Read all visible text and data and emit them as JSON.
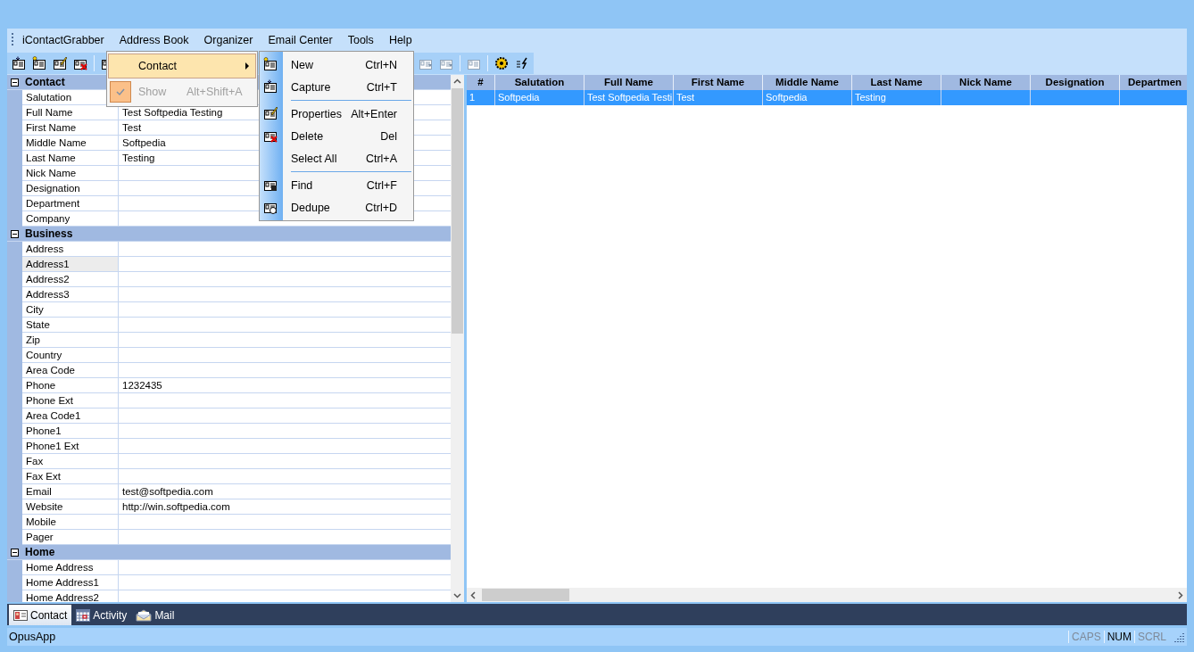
{
  "menu_bar": {
    "items": [
      {
        "label": "iContactGrabber"
      },
      {
        "label": "Address Book"
      },
      {
        "label": "Organizer"
      },
      {
        "label": "Email Center"
      },
      {
        "label": "Tools"
      },
      {
        "label": "Help"
      }
    ]
  },
  "toolbar": {
    "left_groups": [
      {
        "buttons": [
          {
            "kind": "capture"
          },
          {
            "kind": "new"
          },
          {
            "kind": "properties"
          },
          {
            "kind": "delete"
          }
        ]
      },
      {
        "buttons": [
          {
            "kind": "find"
          }
        ]
      }
    ],
    "right_groups": [
      {
        "buttons": [
          {
            "kind": "forward"
          },
          {
            "kind": "forward"
          }
        ]
      },
      {
        "buttons": [
          {
            "kind": "grid"
          }
        ]
      },
      {
        "buttons": [
          {
            "kind": "gear"
          },
          {
            "kind": "tools"
          }
        ]
      }
    ]
  },
  "property_grid": {
    "groups": [
      {
        "label": "Contact",
        "expanded": true,
        "rows": [
          {
            "name": "Salutation",
            "selected": false
          },
          {
            "name": "Full Name",
            "value": "Test Softpedia Testing",
            "selected": false
          },
          {
            "name": "First Name",
            "value": "Test",
            "selected": false
          },
          {
            "name": "Middle Name",
            "value": "Softpedia",
            "selected": false
          },
          {
            "name": "Last Name",
            "value": "Testing",
            "selected": false
          },
          {
            "name": "Nick Name",
            "selected": false
          },
          {
            "name": "Designation",
            "selected": false
          },
          {
            "name": "Department",
            "selected": false
          },
          {
            "name": "Company",
            "selected": false
          }
        ]
      },
      {
        "label": "Business",
        "expanded": true,
        "rows": [
          {
            "name": "Address",
            "selected": false
          },
          {
            "name": "Address1",
            "selected": true
          },
          {
            "name": "Address2",
            "selected": false
          },
          {
            "name": "Address3",
            "selected": false
          },
          {
            "name": "City",
            "selected": false
          },
          {
            "name": "State",
            "selected": false
          },
          {
            "name": "Zip",
            "selected": false
          },
          {
            "name": "Country",
            "selected": false
          },
          {
            "name": "Area Code",
            "selected": false
          },
          {
            "name": "Phone",
            "value": "1232435",
            "selected": false
          },
          {
            "name": "Phone Ext",
            "selected": false
          },
          {
            "name": "Area Code1",
            "selected": false
          },
          {
            "name": "Phone1",
            "selected": false
          },
          {
            "name": "Phone1 Ext",
            "selected": false
          },
          {
            "name": "Fax",
            "selected": false
          },
          {
            "name": "Fax Ext",
            "selected": false
          },
          {
            "name": "Email",
            "value": "test@softpedia.com",
            "selected": false
          },
          {
            "name": "Website",
            "value": "http://win.softpedia.com",
            "selected": false
          },
          {
            "name": "Mobile",
            "selected": false
          },
          {
            "name": "Pager",
            "selected": false
          }
        ]
      },
      {
        "label": "Home",
        "expanded": true,
        "rows": [
          {
            "name": "Home Address",
            "selected": false
          },
          {
            "name": "Home Address1",
            "selected": false
          },
          {
            "name": "Home Address2",
            "selected": false
          }
        ]
      }
    ]
  },
  "table": {
    "columns": [
      "#",
      "Salutation",
      "Full Name",
      "First Name",
      "Middle Name",
      "Last Name",
      "Nick Name",
      "Designation",
      "Departmen"
    ],
    "rows": [
      {
        "cells": [
          "1",
          "Softpedia",
          "Test Softpedia Testi",
          "Test",
          "Softpedia",
          "Testing",
          null,
          null,
          null
        ],
        "selected": true
      }
    ]
  },
  "bottom_tabs": [
    {
      "kind": "card",
      "label": "Contact",
      "selected": true
    },
    {
      "kind": "calendar",
      "label": "Activity",
      "selected": false
    },
    {
      "kind": "mail",
      "label": "Mail",
      "selected": false
    }
  ],
  "status_bar": {
    "text": "OpusApp",
    "indicators": [
      {
        "label": "CAPS",
        "on": false
      },
      {
        "label": "NUM",
        "on": true
      },
      {
        "label": "SCRL",
        "on": false
      }
    ]
  },
  "address_book_menu": {
    "items": [
      {
        "label": "Contact",
        "submenu": true,
        "selected": true,
        "checked": false,
        "disabled": false
      },
      {
        "label": "Show",
        "shortcut": "Alt+Shift+A",
        "submenu": false,
        "selected": false,
        "checked": true,
        "disabled": true
      }
    ]
  },
  "contact_submenu": {
    "items": [
      {
        "kind": "new",
        "label": "New",
        "shortcut": "Ctrl+N"
      },
      {
        "kind": "capture",
        "label": "Capture",
        "shortcut": "Ctrl+T"
      },
      {
        "kind": "separator"
      },
      {
        "kind": "properties",
        "label": "Properties",
        "shortcut": "Alt+Enter"
      },
      {
        "kind": "delete",
        "label": "Delete",
        "shortcut": "Del"
      },
      {
        "kind": "plain",
        "label": "Select All",
        "shortcut": "Ctrl+A"
      },
      {
        "kind": "separator"
      },
      {
        "kind": "find",
        "label": "Find",
        "shortcut": "Ctrl+F"
      },
      {
        "kind": "dedupe",
        "label": "Dedupe",
        "shortcut": "Ctrl+D"
      }
    ]
  }
}
